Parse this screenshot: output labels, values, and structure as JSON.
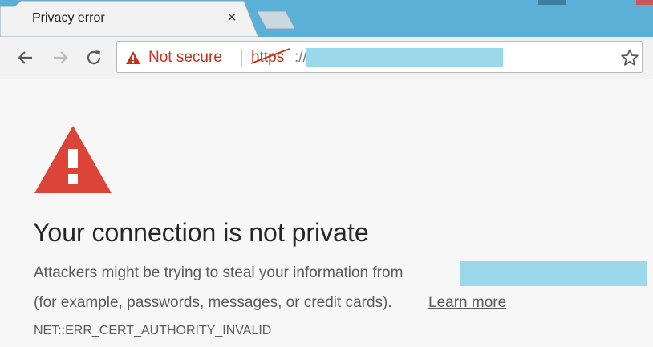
{
  "tab": {
    "title": "Privacy error",
    "close_glyph": "×"
  },
  "omnibox": {
    "security_label": "Not secure",
    "scheme": "https",
    "scheme_separator": "://"
  },
  "icons": {
    "back": "arrow-left-icon",
    "forward": "arrow-right-icon",
    "reload": "reload-icon",
    "warning": "warning-triangle-icon",
    "bookmark": "star-icon"
  },
  "colors": {
    "titlebar": "#5bb0d8",
    "warning_red": "#c5321e",
    "big_warning_red": "#db4437",
    "redaction": "#9bd9ea"
  },
  "interstitial": {
    "heading": "Your connection is not private",
    "description_line1": "Attackers might be trying to steal your information from",
    "description_line2": "(for example, passwords, messages, or credit cards).",
    "learn_more": "Learn more",
    "error_code": "NET::ERR_CERT_AUTHORITY_INVALID"
  }
}
